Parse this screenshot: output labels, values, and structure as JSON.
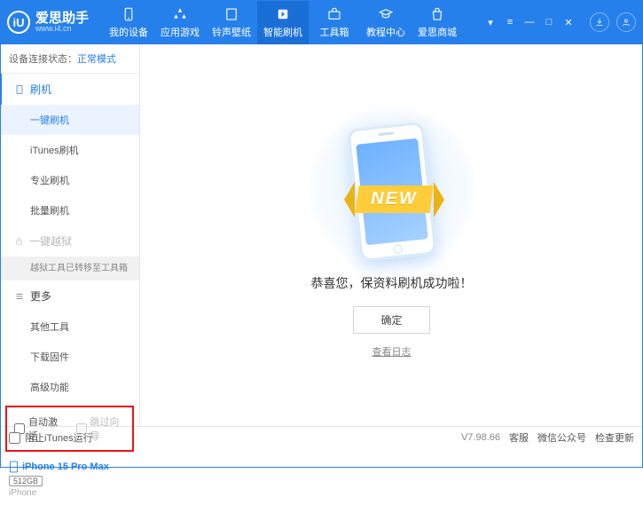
{
  "brand": {
    "badge": "iU",
    "name": "爱思助手",
    "url": "www.i4.cn"
  },
  "nav": {
    "items": [
      {
        "label": "我的设备"
      },
      {
        "label": "应用游戏"
      },
      {
        "label": "铃声壁纸"
      },
      {
        "label": "智能刷机"
      },
      {
        "label": "工具箱"
      },
      {
        "label": "教程中心"
      },
      {
        "label": "爱思商城"
      }
    ],
    "activeIndex": 3
  },
  "status": {
    "label": "设备连接状态：",
    "value": "正常模式"
  },
  "sidebar": {
    "flash": {
      "head": "刷机",
      "items": [
        "一键刷机",
        "iTunes刷机",
        "专业刷机",
        "批量刷机"
      ],
      "selectedIndex": 0
    },
    "jailbreak": {
      "head": "一键越狱",
      "note": "越狱工具已转移至工具箱"
    },
    "more": {
      "head": "更多",
      "items": [
        "其他工具",
        "下载固件",
        "高级功能"
      ]
    }
  },
  "options": {
    "autoActivate": "自动激活",
    "skipSetup": "跳过向导"
  },
  "device": {
    "name": "iPhone 15 Pro Max",
    "storage": "512GB",
    "type": "iPhone"
  },
  "main": {
    "ribbon": "NEW",
    "successText": "恭喜您，保资料刷机成功啦！",
    "okButton": "确定",
    "logLink": "查看日志"
  },
  "footer": {
    "blockItunes": "阻止iTunes运行",
    "version": "V7.98.66",
    "links": [
      "客服",
      "微信公众号",
      "检查更新"
    ]
  }
}
